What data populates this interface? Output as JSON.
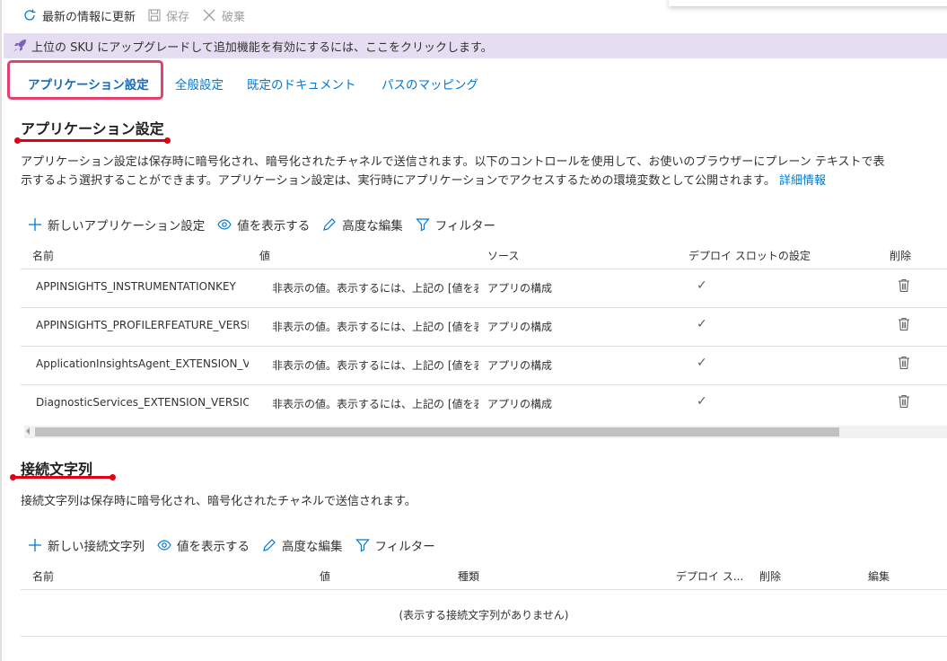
{
  "toolbar": {
    "refresh_label": "最新の情報に更新",
    "save_label": "保存",
    "discard_label": "破棄"
  },
  "banner": {
    "text": "上位の SKU にアップグレードして追加機能を有効にするには、ここをクリックします。"
  },
  "tabs": [
    {
      "label": "アプリケーション設定",
      "active": true
    },
    {
      "label": "全般設定"
    },
    {
      "label": "既定のドキュメント"
    },
    {
      "label": "パスのマッピング"
    }
  ],
  "app_settings": {
    "title": "アプリケーション設定",
    "description_line1": "アプリケーション設定は保存時に暗号化され、暗号化されたチャネルで送信されます。以下のコントロールを使用して、お使いのブラウザーにプレーン テキストで表",
    "description_line2": "示するよう選択することができます。アプリケーション設定は、実行時にアプリケーションでアクセスするための環境変数として公開されます。",
    "more_info_link": "詳細情報",
    "toolbar": {
      "new_label": "新しいアプリケーション設定",
      "show_values_label": "値を表示する",
      "advanced_edit_label": "高度な編集",
      "filter_label": "フィルター"
    },
    "columns": [
      "名前",
      "値",
      "ソース",
      "デプロイ スロットの設定",
      "削除"
    ],
    "rows": [
      {
        "name": "APPINSIGHTS_INSTRUMENTATIONKEY",
        "value": "非表示の値。表示するには、上記の [値を表示する] をクリックします",
        "source": "アプリの構成"
      },
      {
        "name": "APPINSIGHTS_PROFILERFEATURE_VERSION",
        "value": "非表示の値。表示するには、上記の [値を表示する] をクリックします",
        "source": "アプリの構成"
      },
      {
        "name": "ApplicationInsightsAgent_EXTENSION_VERSION",
        "value": "非表示の値。表示するには、上記の [値を表示する] をクリックします",
        "source": "アプリの構成"
      },
      {
        "name": "DiagnosticServices_EXTENSION_VERSION",
        "value": "非表示の値。表示するには、上記の [値を表示する] をクリックします",
        "source": "アプリの構成"
      }
    ],
    "check_glyph": "✓"
  },
  "connection_strings": {
    "title": "接続文字列",
    "description": "接続文字列は保存時に暗号化され、暗号化されたチャネルで送信されます。",
    "toolbar": {
      "new_label": "新しい接続文字列",
      "show_values_label": "値を表示する",
      "advanced_edit_label": "高度な編集",
      "filter_label": "フィルター"
    },
    "columns": [
      "名前",
      "値",
      "種類",
      "デプロイ ス...",
      "削除",
      "編集"
    ],
    "empty_message": "(表示する接続文字列がありません)"
  },
  "colors": {
    "accent": "#0078d4",
    "banner_bg": "#e5def3",
    "highlight": "#e3416e",
    "underline": "#e00012"
  }
}
